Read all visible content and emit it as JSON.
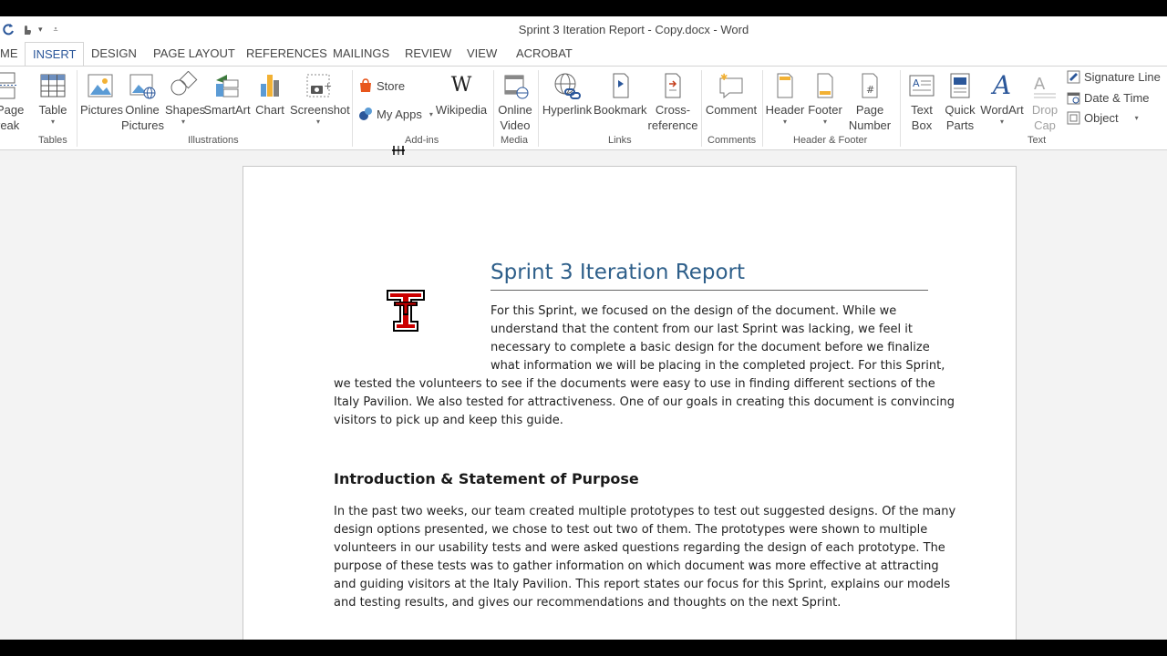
{
  "window": {
    "title": "Sprint 3 Iteration Report - Copy.docx - Word"
  },
  "tabs": [
    {
      "label": "ME",
      "active": false
    },
    {
      "label": "INSERT",
      "active": true
    },
    {
      "label": "DESIGN",
      "active": false
    },
    {
      "label": "PAGE LAYOUT",
      "active": false
    },
    {
      "label": "REFERENCES",
      "active": false
    },
    {
      "label": "MAILINGS",
      "active": false
    },
    {
      "label": "REVIEW",
      "active": false
    },
    {
      "label": "VIEW",
      "active": false
    },
    {
      "label": "ACROBAT",
      "active": false
    }
  ],
  "ribbon": {
    "page_break": {
      "line1": "Page",
      "line2": "reak"
    },
    "table": {
      "label": "Table"
    },
    "pictures": {
      "label": "Pictures"
    },
    "online_pictures": {
      "line1": "Online",
      "line2": "Pictures"
    },
    "shapes": {
      "label": "Shapes"
    },
    "smartart": {
      "label": "SmartArt"
    },
    "chart": {
      "label": "Chart"
    },
    "screenshot": {
      "label": "Screenshot"
    },
    "store": {
      "label": "Store"
    },
    "my_apps": {
      "label": "My Apps"
    },
    "wikipedia": {
      "label": "Wikipedia"
    },
    "online_video": {
      "line1": "Online",
      "line2": "Video"
    },
    "hyperlink": {
      "label": "Hyperlink"
    },
    "bookmark": {
      "label": "Bookmark"
    },
    "cross_reference": {
      "line1": "Cross-",
      "line2": "reference"
    },
    "comment": {
      "label": "Comment"
    },
    "header": {
      "label": "Header"
    },
    "footer": {
      "label": "Footer"
    },
    "page_number": {
      "line1": "Page",
      "line2": "Number"
    },
    "text_box": {
      "line1": "Text",
      "line2": "Box"
    },
    "quick_parts": {
      "line1": "Quick",
      "line2": "Parts"
    },
    "wordart": {
      "label": "WordArt"
    },
    "drop_cap": {
      "line1": "Drop",
      "line2": "Cap"
    },
    "signature_line": {
      "label": "Signature Line"
    },
    "date_time": {
      "label": "Date & Time"
    },
    "object": {
      "label": "Object"
    },
    "groups": {
      "tables": "Tables",
      "illustrations": "Illustrations",
      "addins": "Add-ins",
      "media": "Media",
      "links": "Links",
      "comments": "Comments",
      "header_footer": "Header & Footer",
      "text": "Text"
    }
  },
  "document": {
    "title": "Sprint 3 Iteration Report",
    "intro_lines": [
      "For this Sprint, we focused on the design of the document. While we",
      "understand that the content from our last Sprint was lacking, we feel it",
      "necessary to complete a basic design for the document before we finalize",
      "what information we will be placing in the completed project. For this Sprint,",
      "we tested the volunteers to see if the documents were easy to use in finding different sections of the",
      "Italy Pavilion. We also tested for attractiveness. One of our goals in creating this document is convincing",
      "visitors to pick up and keep this guide."
    ],
    "heading": "Introduction & Statement of Purpose",
    "body_lines": [
      "In the past two weeks, our team created multiple prototypes to test out suggested designs. Of the many",
      "design options presented, we chose to test out two of them. The prototypes were shown to multiple",
      "volunteers in our usability tests and were asked questions regarding the design of each prototype. The",
      "purpose of these tests was to gather information on which document was more effective at attracting",
      "and guiding visitors at the Italy Pavilion. This report states our focus for this Sprint, explains our models",
      "and testing results, and gives our recommendations and thoughts on the next Sprint."
    ]
  },
  "colors": {
    "accent": "#2b579a",
    "title_blue": "#2e5f8a",
    "logo_red": "#cc0000"
  }
}
